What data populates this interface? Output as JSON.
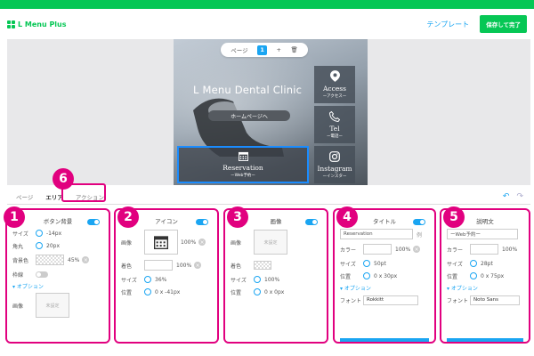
{
  "header": {
    "logo": "L Menu Plus",
    "template_link": "テンプレート",
    "save_button": "保存して完了"
  },
  "preview": {
    "pager": {
      "label": "ページ",
      "current": "1",
      "add": "+",
      "delete": "🗑"
    },
    "clinic_title": "L Menu Dental Clinic",
    "home_button": "ホームページへ",
    "tiles": [
      {
        "icon": "location-pin-icon",
        "label": "Access",
        "sub": "ーアクセスー"
      },
      {
        "icon": "phone-icon",
        "label": "Tel",
        "sub": "ー電話ー"
      },
      {
        "icon": "instagram-icon",
        "label": "Instagram",
        "sub": "ーインスター"
      }
    ],
    "reservation": {
      "icon": "calendar-icon",
      "label": "Reservation",
      "sub": "ーWeb予約ー"
    }
  },
  "tabs": {
    "items": [
      "ページ",
      "エリア",
      "アクション"
    ],
    "active": "エリア",
    "undo": "↶",
    "redo": "↷"
  },
  "annotations": {
    "tab_badge": "6",
    "panel_badges": [
      "1",
      "2",
      "3",
      "4",
      "5"
    ]
  },
  "panels": {
    "p1": {
      "title": "ボタン背景",
      "size_label": "サイズ",
      "size_value": "-14px",
      "radius_label": "角丸",
      "radius_value": "20px",
      "bgcolor_label": "背景色",
      "bgcolor_value": "45%",
      "border_label": "枠線",
      "option_label": "▾ オプション",
      "image_label": "画像",
      "image_placeholder": "未設定"
    },
    "p2": {
      "title": "アイコン",
      "image_label": "画像",
      "image_value": "100%",
      "color_label": "着色",
      "color_value": "100%",
      "size_label": "サイズ",
      "size_value": "36%",
      "pos_label": "位置",
      "pos_value": "0 x -41px"
    },
    "p3": {
      "title": "画像",
      "image_label": "画像",
      "image_placeholder": "未設定",
      "color_label": "着色",
      "size_label": "サイズ",
      "size_value": "100%",
      "pos_label": "位置",
      "pos_value": "0 x 0px"
    },
    "p4": {
      "title": "タイトル",
      "text_value": "Reservation",
      "side_label": "例",
      "color_label": "カラー",
      "color_value": "100%",
      "size_label": "サイズ",
      "size_value": "50pt",
      "pos_label": "位置",
      "pos_value": "0 x 30px",
      "option_label": "▾ オプション",
      "font_label": "フォント",
      "font_value": "Rokkitt"
    },
    "p5": {
      "title": "説明文",
      "text_value": "ーWeb予約ー",
      "color_label": "カラー",
      "color_value": "100%",
      "size_label": "サイズ",
      "size_value": "28pt",
      "pos_label": "位置",
      "pos_value": "0 x 75px",
      "option_label": "▾ オプション",
      "font_label": "フォント",
      "font_value": "Noto Sans"
    }
  },
  "colors": {
    "brand_green": "#06c755",
    "accent_blue": "#1aa5f2",
    "annotation_pink": "#e1007f"
  }
}
